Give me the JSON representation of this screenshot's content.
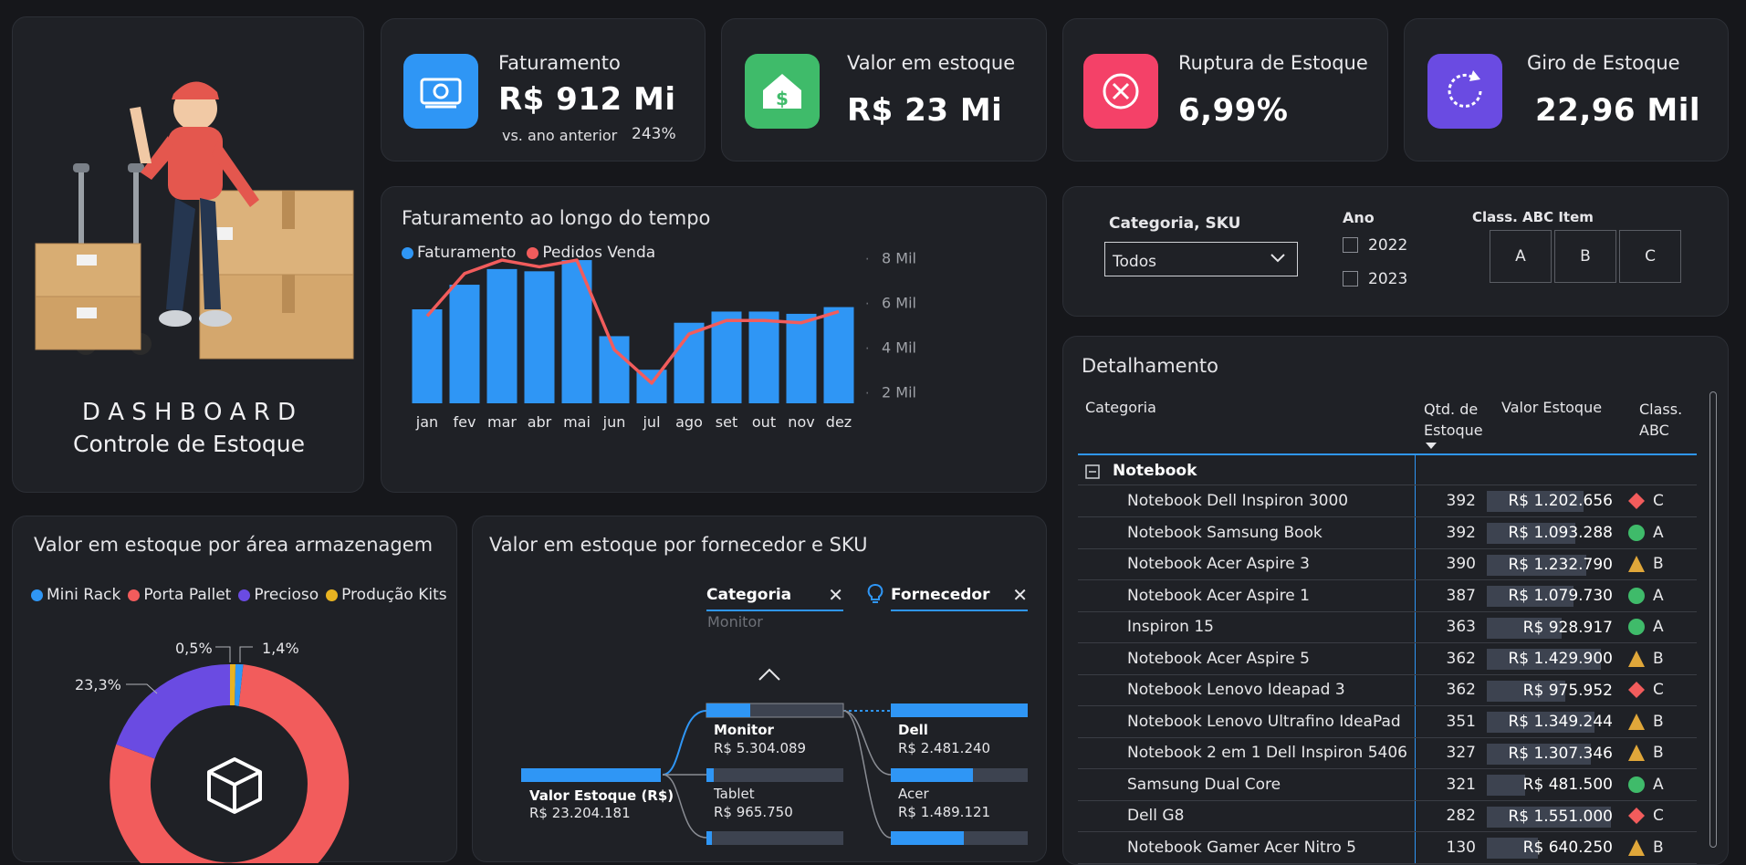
{
  "hero": {
    "title_line1": "D A S H B O A R D",
    "title_line2": "Controle de Estoque"
  },
  "kpis": [
    {
      "title": "Faturamento",
      "value": "R$ 912 Mi",
      "compare_label": "vs. ano anterior",
      "compare_value": "243%",
      "icon": "money-icon",
      "color": "#2f96f5"
    },
    {
      "title": "Valor em estoque",
      "value": "R$ 23 Mi",
      "icon": "house-dollar-icon",
      "color": "#3fbb6a"
    },
    {
      "title": "Ruptura de Estoque",
      "value": "6,99%",
      "icon": "x-circle-icon",
      "color": "#f44168"
    },
    {
      "title": "Giro de Estoque",
      "value": "22,96 Mil",
      "icon": "refresh-icon",
      "color": "#6a4be2"
    }
  ],
  "filters": {
    "category_label": "Categoria, SKU",
    "category_value": "Todos",
    "year_label": "Ano",
    "years": [
      "2022",
      "2023"
    ],
    "abc_label": "Class. ABC Item",
    "abc_options": [
      "A",
      "B",
      "C"
    ]
  },
  "combo_chart": {
    "title": "Faturamento ao longo do tempo",
    "legend": [
      "Faturamento",
      "Pedidos Venda"
    ],
    "colors": {
      "bar": "#2f96f5",
      "line": "#f25c5c"
    }
  },
  "donut": {
    "title": "Valor em estoque por área armazenagem",
    "legend": [
      "Mini Rack",
      "Porta Pallet",
      "Precioso",
      "Produção Kits"
    ],
    "colors": [
      "#2f96f5",
      "#f25c5c",
      "#6a4be2",
      "#e8b321"
    ],
    "labels": [
      "0,5%",
      "1,4%",
      "23,3%"
    ],
    "icon": "box-icon"
  },
  "tree": {
    "title": "Valor em estoque por fornecedor e SKU",
    "level1_label": "Categoria",
    "level1_selected": "Monitor",
    "level2_label": "Fornecedor",
    "root": {
      "name": "Valor Estoque (R$)",
      "value": "R$ 23.204.181"
    },
    "categories": [
      {
        "name": "Monitor",
        "value": "R$ 5.304.089"
      },
      {
        "name": "Tablet",
        "value": "R$ 965.750"
      }
    ],
    "suppliers": [
      {
        "name": "Dell",
        "value": "R$ 2.481.240"
      },
      {
        "name": "Acer",
        "value": "R$ 1.489.121"
      }
    ]
  },
  "detail": {
    "title": "Detalhamento",
    "headers": {
      "category": "Categoria",
      "qty_1": "Qtd. de",
      "qty_2": "Estoque",
      "value": "Valor Estoque",
      "abc_1": "Class.",
      "abc_2": "ABC"
    },
    "group": "Notebook",
    "rows": [
      {
        "name": "Notebook Dell Inspiron 3000",
        "qty": "392",
        "value": "R$ 1.202.656",
        "abc": "C",
        "pct": 0.78
      },
      {
        "name": "Notebook Samsung Book",
        "qty": "392",
        "value": "R$ 1.093.288",
        "abc": "A",
        "pct": 0.71
      },
      {
        "name": "Notebook Acer Aspire 3",
        "qty": "390",
        "value": "R$ 1.232.790",
        "abc": "B",
        "pct": 0.8
      },
      {
        "name": "Notebook Acer Aspire 1",
        "qty": "387",
        "value": "R$ 1.079.730",
        "abc": "A",
        "pct": 0.7
      },
      {
        "name": "Inspiron 15",
        "qty": "363",
        "value": "R$ 928.917",
        "abc": "A",
        "pct": 0.6
      },
      {
        "name": "Notebook Acer Aspire 5",
        "qty": "362",
        "value": "R$ 1.429.900",
        "abc": "B",
        "pct": 0.92
      },
      {
        "name": "Notebook Lenovo Ideapad 3",
        "qty": "362",
        "value": "R$ 975.952",
        "abc": "C",
        "pct": 0.63
      },
      {
        "name": "Notebook Lenovo Ultrafino IdeaPad",
        "qty": "351",
        "value": "R$ 1.349.244",
        "abc": "B",
        "pct": 0.87
      },
      {
        "name": "Notebook 2 em 1 Dell Inspiron 5406",
        "qty": "327",
        "value": "R$ 1.307.346",
        "abc": "B",
        "pct": 0.84
      },
      {
        "name": "Samsung Dual Core",
        "qty": "321",
        "value": "R$ 481.500",
        "abc": "A",
        "pct": 0.31
      },
      {
        "name": "Dell G8",
        "qty": "282",
        "value": "R$ 1.551.000",
        "abc": "C",
        "pct": 1.0
      },
      {
        "name": "Notebook Gamer Acer Nitro 5",
        "qty": "130",
        "value": "R$ 640.250",
        "abc": "B",
        "pct": 0.41
      }
    ]
  },
  "chart_data": {
    "type": "bar",
    "categories": [
      "jan",
      "fev",
      "mar",
      "abr",
      "mai",
      "jun",
      "jul",
      "ago",
      "set",
      "out",
      "nov",
      "dez"
    ],
    "series": [
      {
        "name": "Faturamento",
        "type": "bar",
        "values": [
          5.7,
          6.8,
          7.5,
          7.4,
          7.9,
          4.5,
          3.0,
          5.1,
          5.6,
          5.6,
          5.5,
          5.8
        ]
      },
      {
        "name": "Pedidos Venda",
        "type": "line",
        "values": [
          5.4,
          7.3,
          7.9,
          7.6,
          7.9,
          3.9,
          2.4,
          4.6,
          5.2,
          5.2,
          5.1,
          5.6
        ]
      }
    ],
    "yticks": [
      "2 Mil",
      "4 Mil",
      "6 Mil",
      "8 Mil"
    ],
    "ylim": [
      1.5,
      8.8
    ]
  }
}
